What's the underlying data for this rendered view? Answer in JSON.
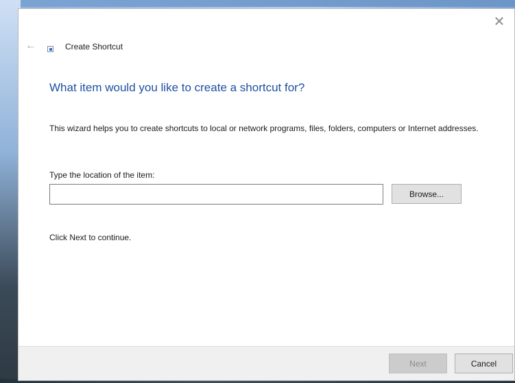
{
  "window": {
    "title": "Create Shortcut",
    "close_glyph": "✕",
    "back_glyph": "←"
  },
  "wizard": {
    "headline": "What item would you like to create a shortcut for?",
    "description": "This wizard helps you to create shortcuts to local or network programs, files, folders, computers or Internet addresses.",
    "location_label": "Type the location of the item:",
    "location_value": "",
    "browse_label": "Browse...",
    "continue_text": "Click Next to continue."
  },
  "footer": {
    "next_label": "Next",
    "cancel_label": "Cancel"
  },
  "colors": {
    "headline": "#1e4fa1",
    "footer_bg": "#f0f0f0"
  }
}
